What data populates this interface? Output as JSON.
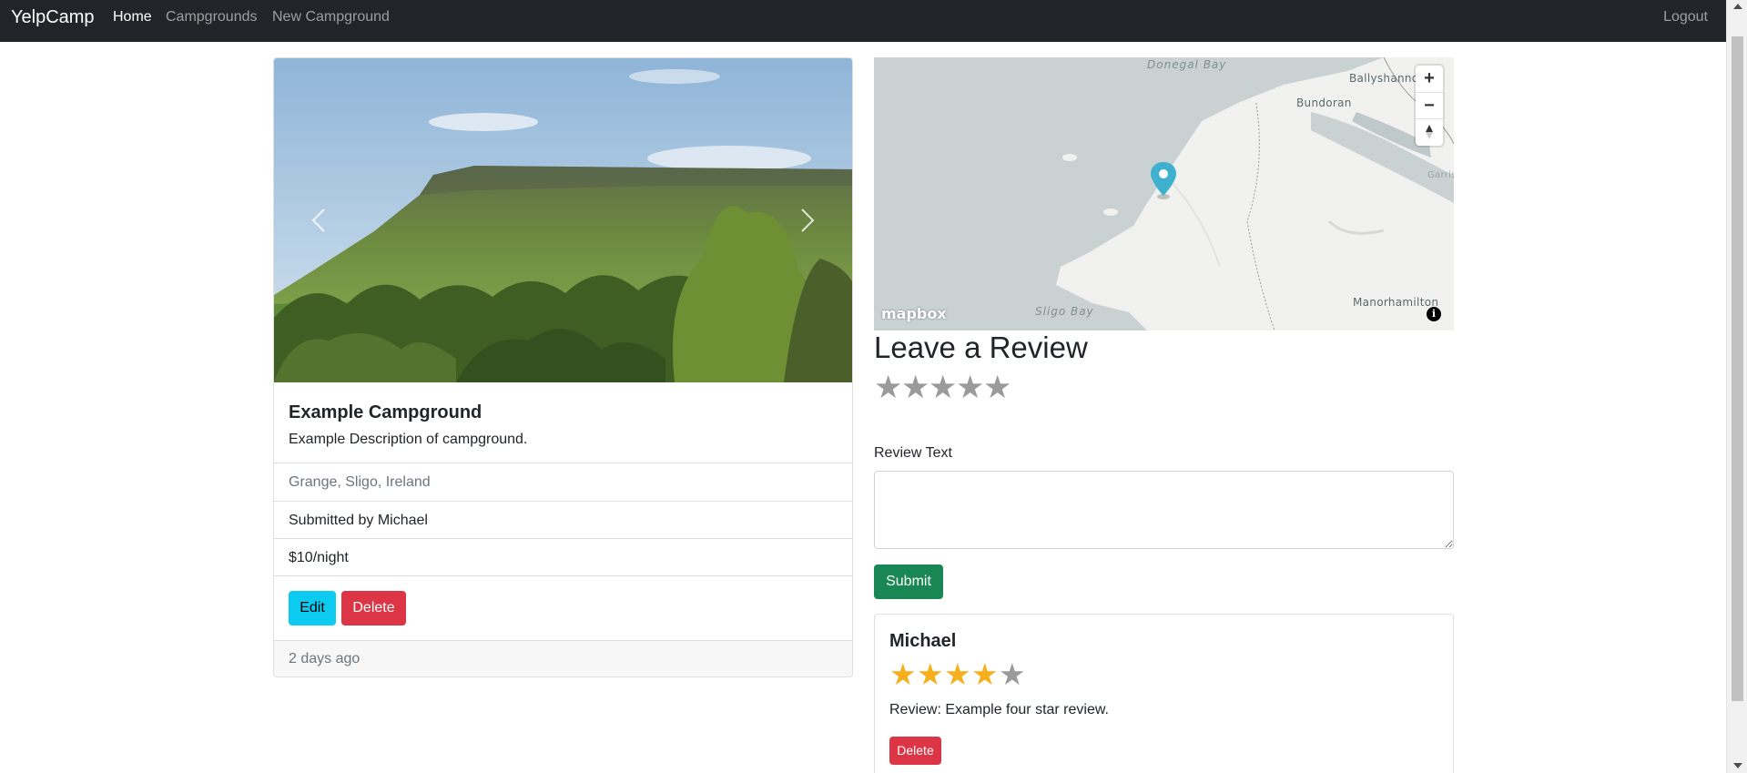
{
  "navbar": {
    "brand": "YelpCamp",
    "links": [
      "Home",
      "Campgrounds",
      "New Campground"
    ],
    "logout": "Logout"
  },
  "campground": {
    "title": "Example Campground",
    "description": "Example Description of campground.",
    "location": "Grange, Sligo, Ireland",
    "submitted_by": "Submitted by Michael",
    "price": "$10/night",
    "edit_label": "Edit",
    "delete_label": "Delete",
    "posted": "2 days ago"
  },
  "map": {
    "labels": {
      "donegal_bay": "Donegal Bay",
      "ballyshannon": "Ballyshannon",
      "bundoran": "Bundoran",
      "sligo_bay": "Sligo Bay",
      "manorhamilton": "Manorhamilton",
      "garrison": "Garris"
    },
    "attribution_logo": "mapbox",
    "zoom_in": "+",
    "zoom_out": "−",
    "info": "i"
  },
  "review_form": {
    "heading": "Leave a Review",
    "rating_max": 5,
    "text_label": "Review Text",
    "submit_label": "Submit"
  },
  "reviews": [
    {
      "author": "Michael",
      "rating": 4,
      "rating_max": 5,
      "body": "Review: Example four star review.",
      "delete_label": "Delete"
    }
  ],
  "colors": {
    "navbar_bg": "#212529",
    "edit_button": "#0dcaf0",
    "delete_button": "#dc3545",
    "submit_button": "#198754",
    "star_filled": "#f6b01e",
    "star_empty": "#9a9a9a",
    "map_marker": "#3fb1ce"
  },
  "icons": {
    "carousel_prev": "chevron-left-icon",
    "carousel_next": "chevron-right-icon",
    "map_marker": "map-pin-icon",
    "compass": "compass-icon"
  }
}
